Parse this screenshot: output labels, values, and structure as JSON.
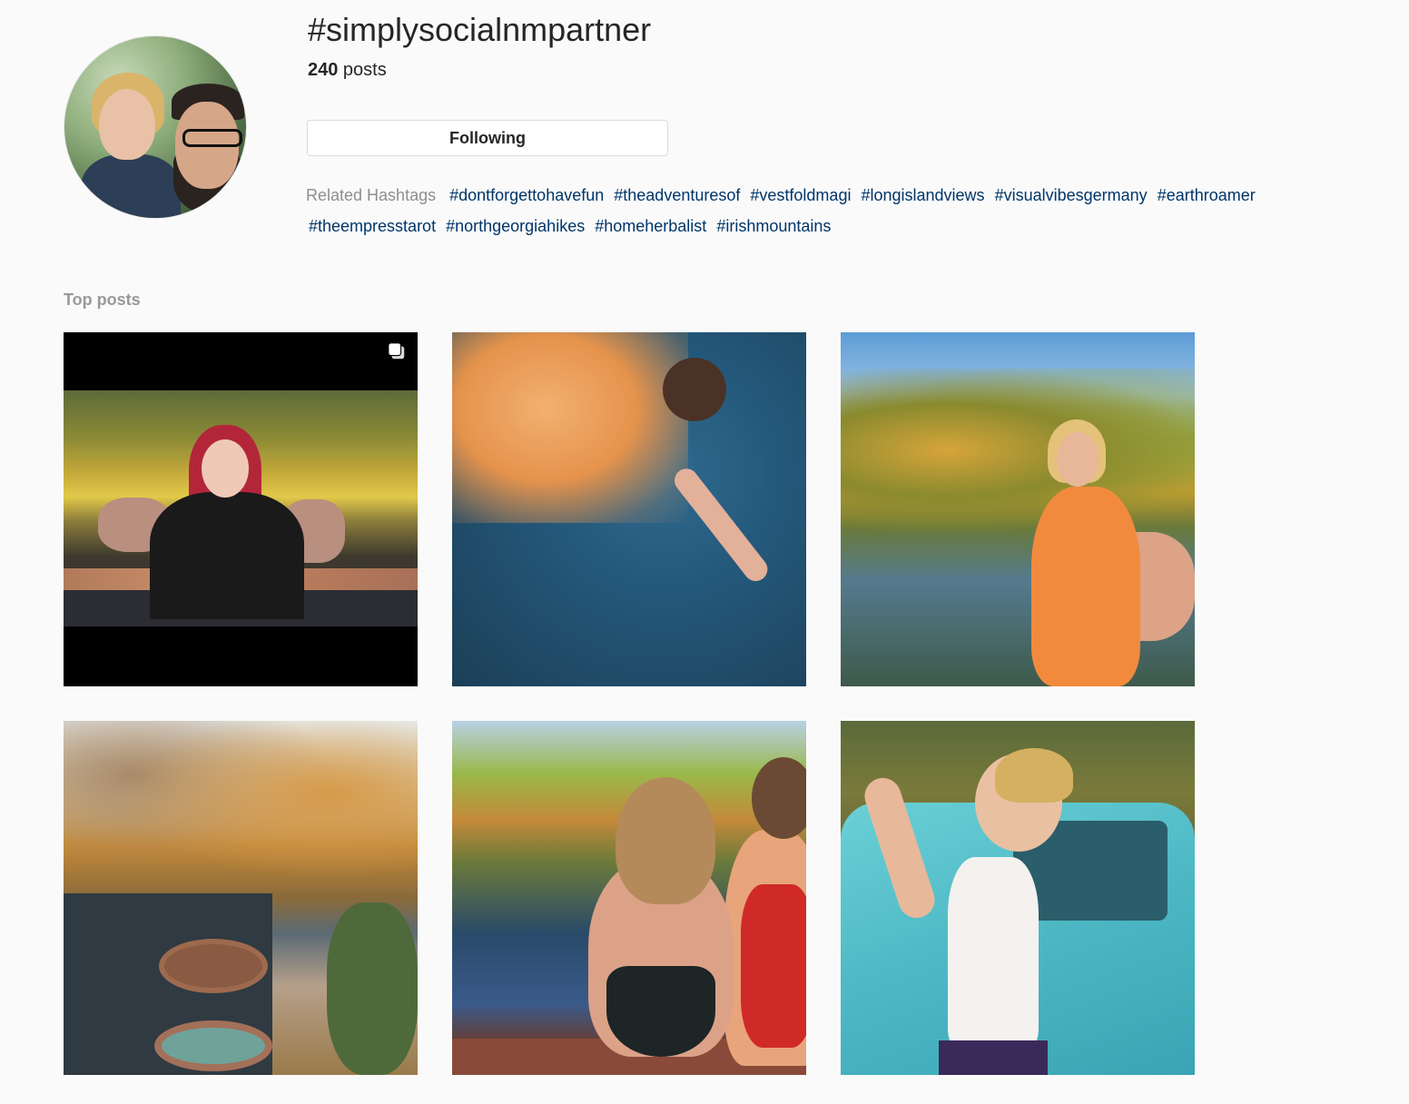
{
  "header": {
    "hashtag": "#simplysocialnmpartner",
    "post_count": "240",
    "post_count_suffix": " posts",
    "follow_button_label": "Following"
  },
  "related": {
    "label": "Related Hashtags",
    "tags": [
      "#dontforgettohavefun",
      "#theadventuresof",
      "#vestfoldmagi",
      "#longislandviews",
      "#visualvibesgermany",
      "#earthroamer",
      "#theempresstarot",
      "#northgeorgiahikes",
      "#homeherbalist",
      "#irishmountains"
    ]
  },
  "top_posts": {
    "label": "Top posts",
    "posts": [
      {
        "icon": "multiple-posts-icon"
      },
      {},
      {},
      {},
      {},
      {}
    ]
  },
  "colors": {
    "background": "#fafafa",
    "link": "#003569",
    "muted": "#8e8e8e",
    "border": "#dbdbdb"
  }
}
